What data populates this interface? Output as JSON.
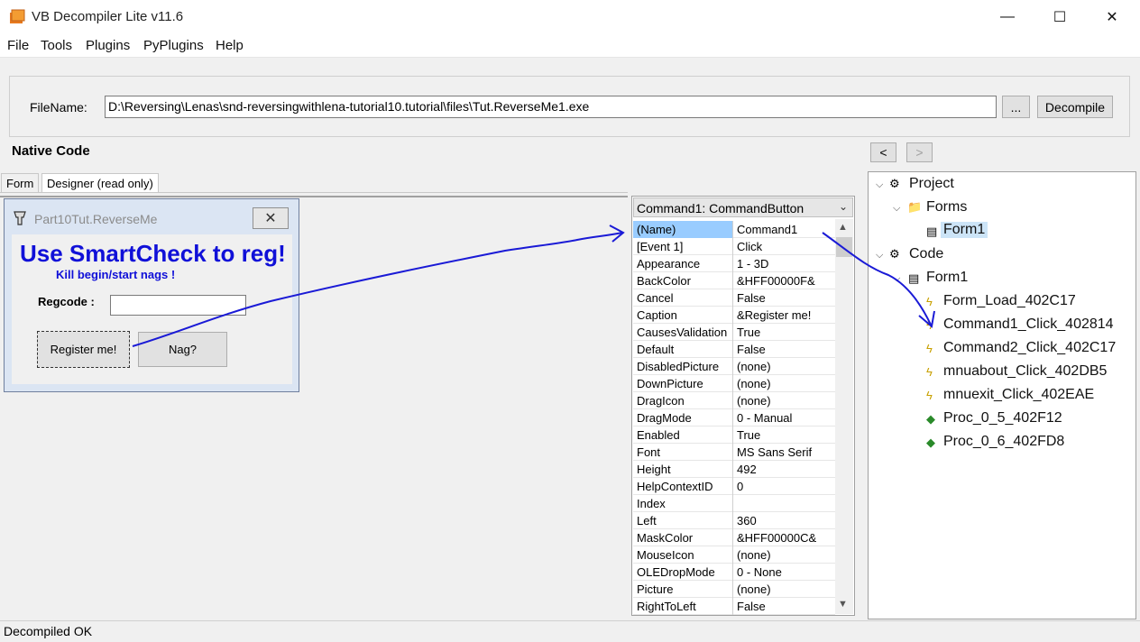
{
  "window": {
    "title": "VB Decompiler Lite v11.6",
    "controls": {
      "minimize": "—",
      "maximize": "☐",
      "close": "✕"
    }
  },
  "menu": [
    "File",
    "Tools",
    "Plugins",
    "PyPlugins",
    "Help"
  ],
  "file": {
    "label": "FileName:",
    "path": "D:\\Reversing\\Lenas\\snd-reversingwithlena-tutorial10.tutorial\\files\\Tut.ReverseMe1.exe",
    "browse_label": "...",
    "decompile_label": "Decompile"
  },
  "section_label": "Native Code",
  "nav": {
    "back": "<",
    "forward": ">"
  },
  "tabs": [
    "Form",
    "Designer (read only)"
  ],
  "form_preview": {
    "title": "Part10Tut.ReverseMe",
    "heading": "Use SmartCheck to reg!",
    "subheading": "Kill begin/start nags !",
    "regcode_label": "Regcode :",
    "register_button": "Register me!",
    "nag_button": "Nag?"
  },
  "properties": {
    "object": "Command1: CommandButton",
    "rows": [
      {
        "name": "(Name)",
        "value": "Command1",
        "selected": true
      },
      {
        "name": "[Event 1]",
        "value": "Click"
      },
      {
        "name": "Appearance",
        "value": "1 - 3D"
      },
      {
        "name": "BackColor",
        "value": "&HFF00000F&"
      },
      {
        "name": "Cancel",
        "value": "False"
      },
      {
        "name": "Caption",
        "value": "&Register me!"
      },
      {
        "name": "CausesValidation",
        "value": "True"
      },
      {
        "name": "Default",
        "value": "False"
      },
      {
        "name": "DisabledPicture",
        "value": "(none)"
      },
      {
        "name": "DownPicture",
        "value": "(none)"
      },
      {
        "name": "DragIcon",
        "value": "(none)"
      },
      {
        "name": "DragMode",
        "value": "0 - Manual"
      },
      {
        "name": "Enabled",
        "value": "True"
      },
      {
        "name": "Font",
        "value": "MS Sans Serif"
      },
      {
        "name": "Height",
        "value": "492"
      },
      {
        "name": "HelpContextID",
        "value": "0"
      },
      {
        "name": "Index",
        "value": ""
      },
      {
        "name": "Left",
        "value": "360"
      },
      {
        "name": "MaskColor",
        "value": "&HFF00000C&"
      },
      {
        "name": "MouseIcon",
        "value": "(none)"
      },
      {
        "name": "OLEDropMode",
        "value": "0 - None"
      },
      {
        "name": "Picture",
        "value": "(none)"
      },
      {
        "name": "RightToLeft",
        "value": "False"
      }
    ]
  },
  "tree": {
    "project": "Project",
    "forms": "Forms",
    "form1": "Form1",
    "code": "Code",
    "code_form1": "Form1",
    "procs": [
      {
        "label": "Form_Load_402C17",
        "icon": "event-icon"
      },
      {
        "label": "Command1_Click_402814",
        "icon": "event-icon"
      },
      {
        "label": "Command2_Click_402C17",
        "icon": "event-icon"
      },
      {
        "label": "mnuabout_Click_402DB5",
        "icon": "event-icon"
      },
      {
        "label": "mnuexit_Click_402EAE",
        "icon": "event-icon"
      },
      {
        "label": "Proc_0_5_402F12",
        "icon": "proc-icon"
      },
      {
        "label": "Proc_0_6_402FD8",
        "icon": "proc-icon"
      }
    ]
  },
  "status": "Decompiled OK",
  "colors": {
    "annotation_arrow": "#1a1ad6",
    "form_heading": "#1010d8",
    "selected_row": "#99ccff"
  }
}
